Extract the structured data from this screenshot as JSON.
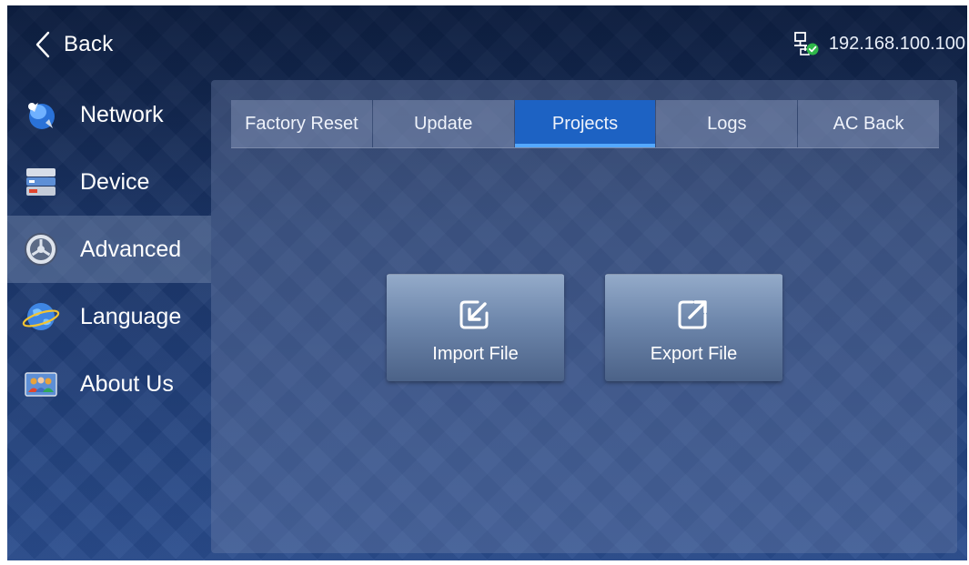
{
  "header": {
    "back_label": "Back",
    "ip_address": "192.168.100.100",
    "network_icon": "network-connected-icon"
  },
  "sidebar": {
    "items": [
      {
        "label": "Network",
        "icon": "network-icon",
        "active": false
      },
      {
        "label": "Device",
        "icon": "device-icon",
        "active": false
      },
      {
        "label": "Advanced",
        "icon": "advanced-gear-icon",
        "active": true
      },
      {
        "label": "Language",
        "icon": "globe-icon",
        "active": false
      },
      {
        "label": "About Us",
        "icon": "about-us-icon",
        "active": false
      }
    ]
  },
  "tabs": [
    {
      "label": "Factory Reset",
      "active": false
    },
    {
      "label": "Update",
      "active": false
    },
    {
      "label": "Projects",
      "active": true
    },
    {
      "label": "Logs",
      "active": false
    },
    {
      "label": "AC Back",
      "active": false
    }
  ],
  "actions": {
    "import_label": "Import File",
    "import_icon": "import-file-icon",
    "export_label": "Export File",
    "export_icon": "export-file-icon"
  },
  "colors": {
    "active_tab": "#1d62c3",
    "active_tab_underline": "#54a8ff",
    "status_ok": "#2fb84a"
  }
}
